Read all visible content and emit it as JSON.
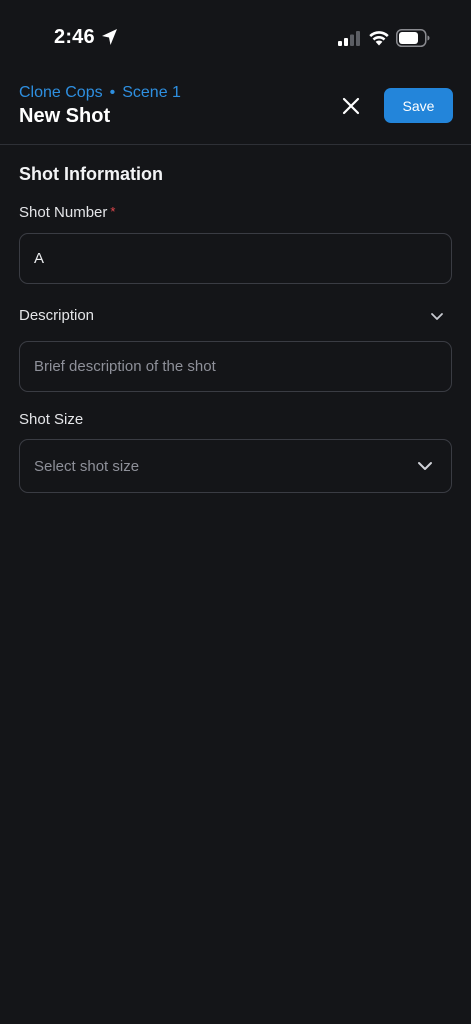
{
  "status_bar": {
    "time": "2:46"
  },
  "header": {
    "breadcrumb": {
      "project": "Clone Cops",
      "separator": "•",
      "scene": "Scene 1"
    },
    "title": "New Shot",
    "save_label": "Save"
  },
  "form": {
    "section_title": "Shot Information",
    "shot_number": {
      "label": "Shot Number",
      "required_mark": "*",
      "value": "A"
    },
    "description": {
      "label": "Description",
      "placeholder": "Brief description of the shot"
    },
    "shot_size": {
      "label": "Shot Size",
      "placeholder": "Select shot size"
    }
  },
  "colors": {
    "background": "#141518",
    "accent": "#2385DA",
    "breadcrumb": "#2E8FE0",
    "required": "#E5484D",
    "border": "#3A3C43"
  },
  "icons": [
    "location-arrow-icon",
    "cellular-signal-icon",
    "wifi-icon",
    "battery-icon",
    "close-icon",
    "chevron-down-icon"
  ]
}
